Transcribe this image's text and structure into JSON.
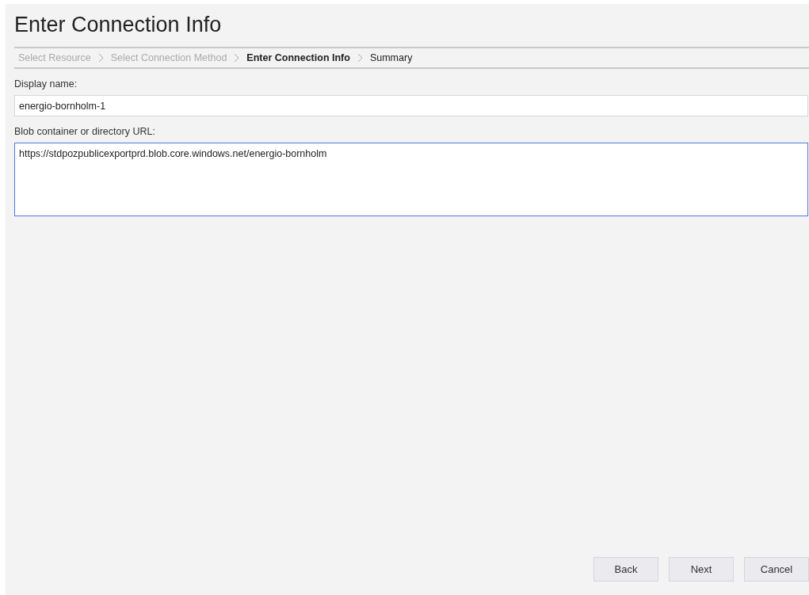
{
  "title": "Enter Connection Info",
  "steps": [
    {
      "label": "Select Resource",
      "selected": false,
      "disabled": true
    },
    {
      "label": "Select Connection Method",
      "selected": false,
      "disabled": true
    },
    {
      "label": "Enter Connection Info",
      "selected": true,
      "disabled": false
    },
    {
      "label": "Summary",
      "selected": false,
      "disabled": false
    }
  ],
  "fields": [
    {
      "label": "Display name:",
      "value": "energio-bornholm-1",
      "kind": "input",
      "focused": false
    },
    {
      "label": "Blob container or directory URL:",
      "value": "https://stdpozpublicexportprd.blob.core.windows.net/energio-bornholm",
      "kind": "textarea",
      "focused": true
    }
  ],
  "buttons": [
    "Back",
    "Next",
    "Cancel"
  ]
}
